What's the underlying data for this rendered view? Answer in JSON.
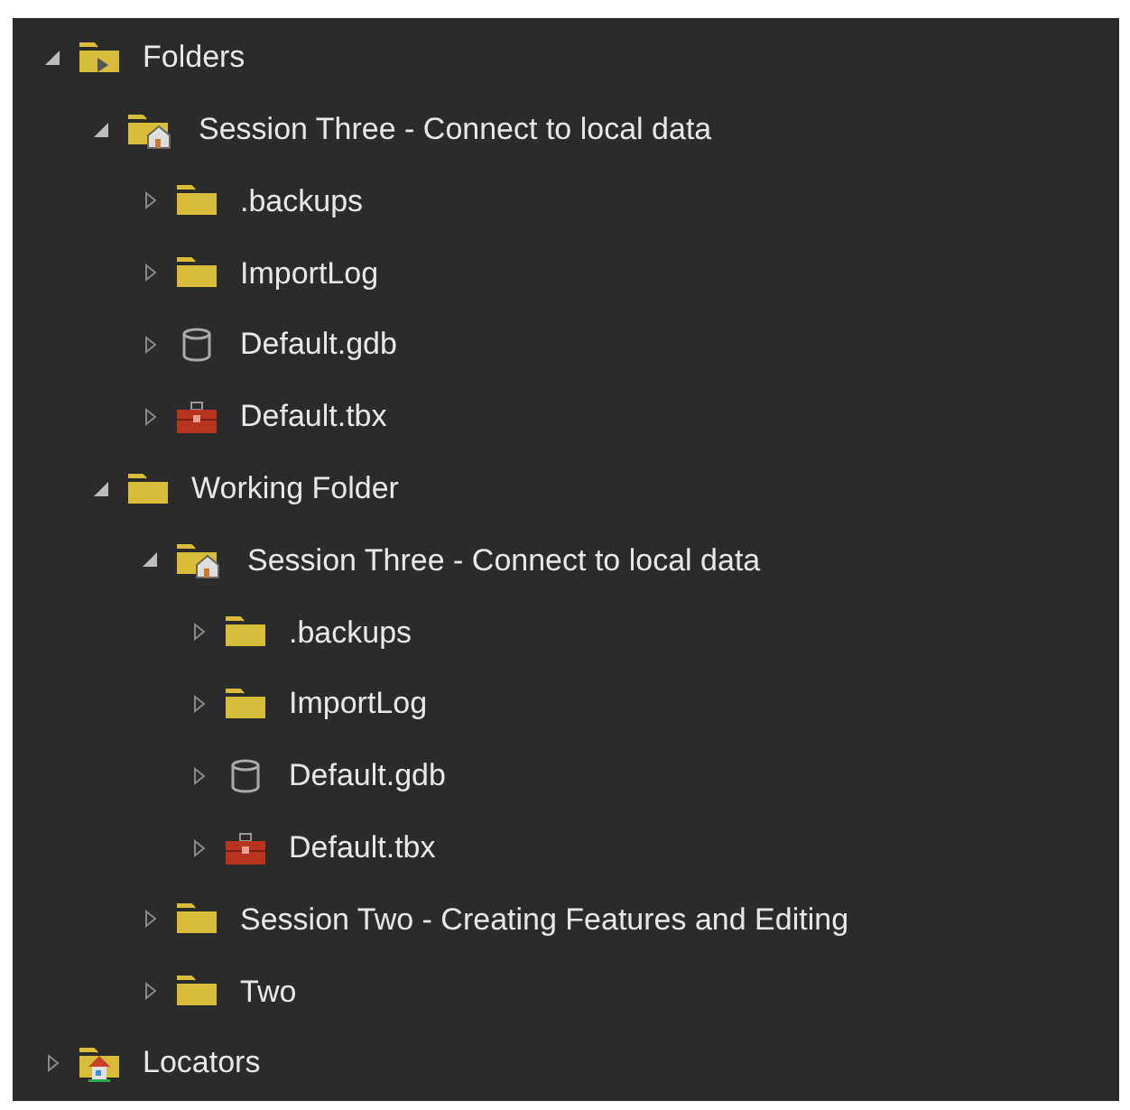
{
  "tree": [
    {
      "label": "Folders",
      "kind": "folders",
      "expanded": true,
      "children": [
        {
          "label": "Session Three - Connect to local data",
          "kind": "home",
          "expanded": true,
          "children": [
            {
              "label": ".backups",
              "kind": "folder",
              "expanded": false
            },
            {
              "label": "ImportLog",
              "kind": "folder",
              "expanded": false
            },
            {
              "label": "Default.gdb",
              "kind": "database",
              "expanded": false
            },
            {
              "label": "Default.tbx",
              "kind": "toolbox",
              "expanded": false
            }
          ]
        },
        {
          "label": "Working Folder",
          "kind": "folder",
          "expanded": true,
          "children": [
            {
              "label": "Session Three - Connect to local data",
              "kind": "home",
              "expanded": true,
              "children": [
                {
                  "label": ".backups",
                  "kind": "folder",
                  "expanded": false
                },
                {
                  "label": "ImportLog",
                  "kind": "folder",
                  "expanded": false
                },
                {
                  "label": "Default.gdb",
                  "kind": "database",
                  "expanded": false
                },
                {
                  "label": "Default.tbx",
                  "kind": "toolbox",
                  "expanded": false
                }
              ]
            },
            {
              "label": "Session Two - Creating Features and Editing",
              "kind": "folder",
              "expanded": false
            },
            {
              "label": "Two",
              "kind": "folder",
              "expanded": false
            }
          ]
        }
      ]
    },
    {
      "label": "Locators",
      "kind": "locators",
      "expanded": false
    }
  ]
}
